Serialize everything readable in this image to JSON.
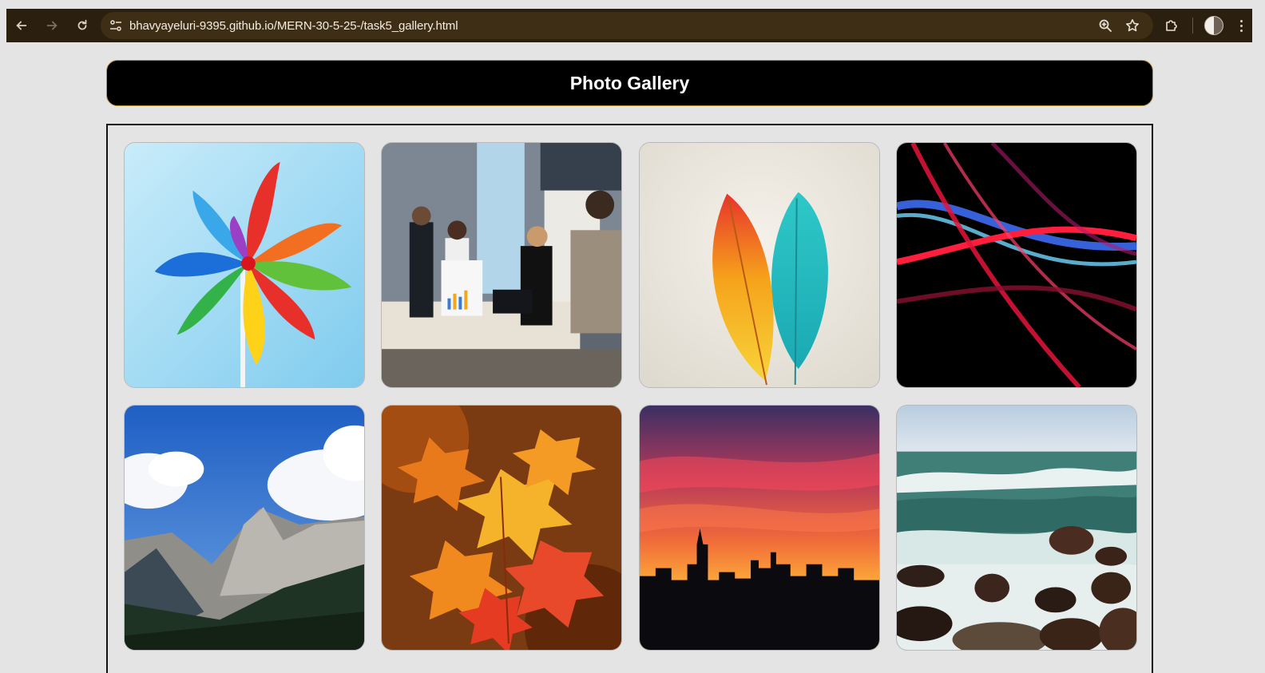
{
  "browser": {
    "url": "bhavyayeluri-9395.github.io/MERN-30-5-25-/task5_gallery.html",
    "back_icon": "arrow-left-icon",
    "forward_icon": "arrow-right-icon",
    "reload_icon": "reload-icon",
    "site_info_icon": "tune-icon",
    "zoom_icon": "zoom-icon",
    "bookmark_icon": "star-icon",
    "extensions_icon": "puzzle-icon",
    "menu_icon": "kebab-menu-icon"
  },
  "header": {
    "title": "Photo Gallery"
  },
  "gallery": {
    "images": [
      {
        "subject": "pinwheel"
      },
      {
        "subject": "office-meeting"
      },
      {
        "subject": "feathers"
      },
      {
        "subject": "light-streaks"
      },
      {
        "subject": "mountains"
      },
      {
        "subject": "autumn-leaves"
      },
      {
        "subject": "city-sunset"
      },
      {
        "subject": "ocean-waves"
      }
    ]
  },
  "colors": {
    "chrome": "#2b1f0f",
    "address_bar": "#3e2e16",
    "page_bg": "#e4e4e4",
    "header_bg": "#000000",
    "header_border": "#b89a3e"
  }
}
